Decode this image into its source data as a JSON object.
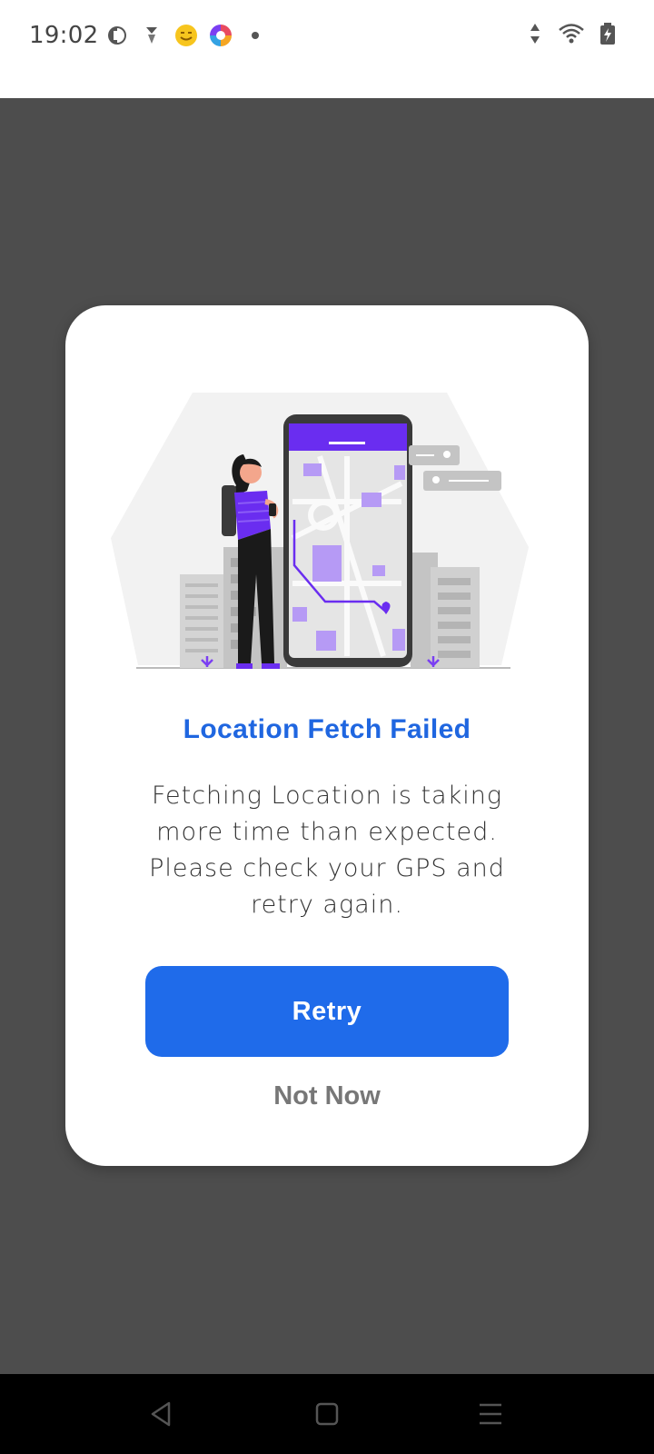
{
  "status_bar": {
    "time": "19:02",
    "left_icons": [
      "privacy-icon",
      "vpn-icon",
      "emoji-app-icon",
      "color-app-icon",
      "dot-icon"
    ],
    "right_icons": [
      "data-arrows-icon",
      "wifi-icon",
      "battery-charging-icon"
    ]
  },
  "dialog": {
    "title": "Location Fetch Failed",
    "message": "Fetching Location is taking more time than expected. Please check your GPS and retry again.",
    "retry_label": "Retry",
    "not_now_label": "Not Now",
    "illustration": "woman-with-phone-map-illustration"
  },
  "nav_bar": {
    "buttons": [
      "back-icon",
      "home-icon",
      "recents-icon"
    ]
  },
  "colors": {
    "accent": "#1f6bea",
    "title": "#1f66e0",
    "scrim": "#4d4d4d",
    "illustration_purple": "#7b3ff2"
  }
}
